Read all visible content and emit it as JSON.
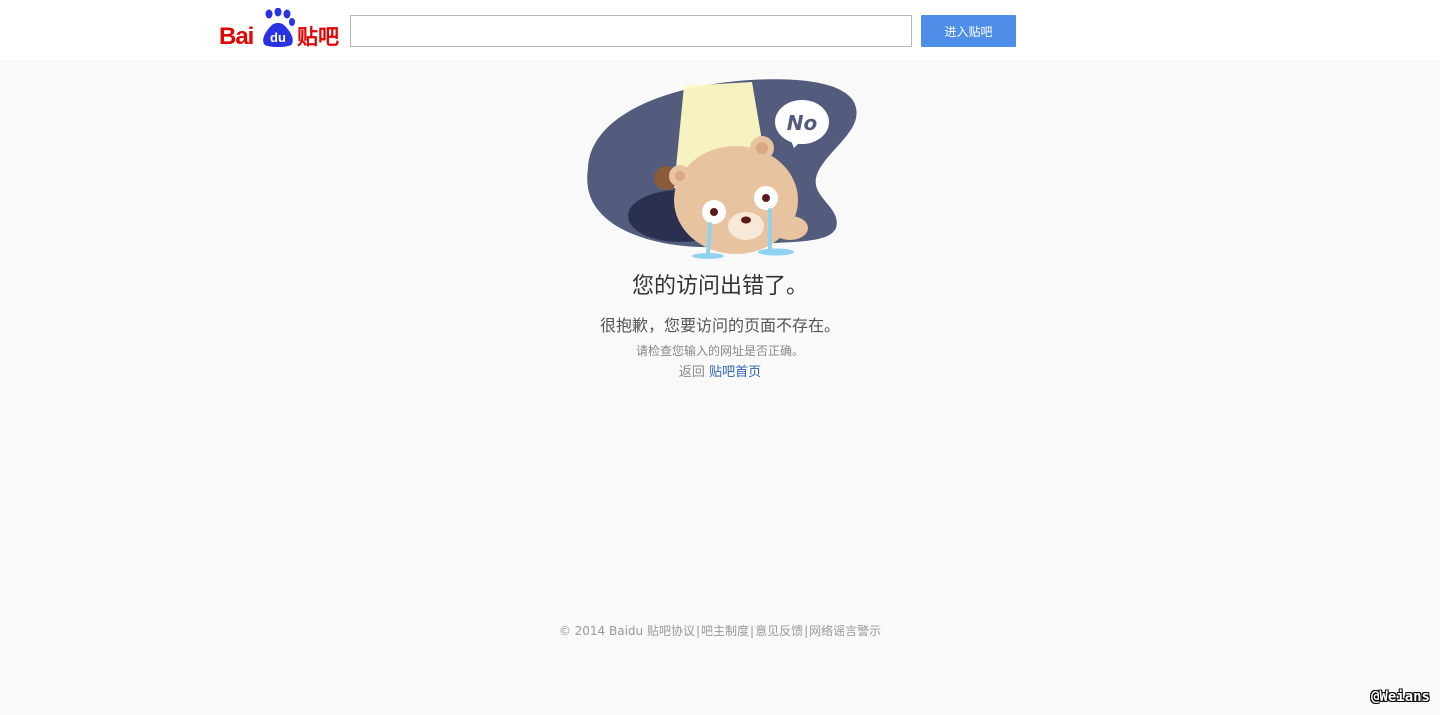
{
  "header": {
    "logo_bai": "Bai",
    "logo_du": "du",
    "logo_tieba": "贴吧",
    "search": {
      "value": "",
      "placeholder": ""
    },
    "enter_button": "进入贴吧"
  },
  "illustration": {
    "speech_bubble": "No"
  },
  "error": {
    "title": "您的访问出错了。",
    "subtitle": "很抱歉，您要访问的页面不存在。",
    "hint": "请检查您输入的网址是否正确。",
    "back_prefix": "返回",
    "back_link": "贴吧首页"
  },
  "footer": {
    "copyright": "© 2014 Baidu",
    "links": [
      "贴吧协议",
      "吧主制度",
      "意见反馈",
      "网络谣言警示"
    ],
    "separator": "|"
  },
  "watermark": "@Weians",
  "colors": {
    "brand_red": "#e10601",
    "brand_blue": "#2932e1",
    "button_blue": "#4e8ee9",
    "link_blue": "#2d64b3",
    "background": "#f9f9f9"
  }
}
